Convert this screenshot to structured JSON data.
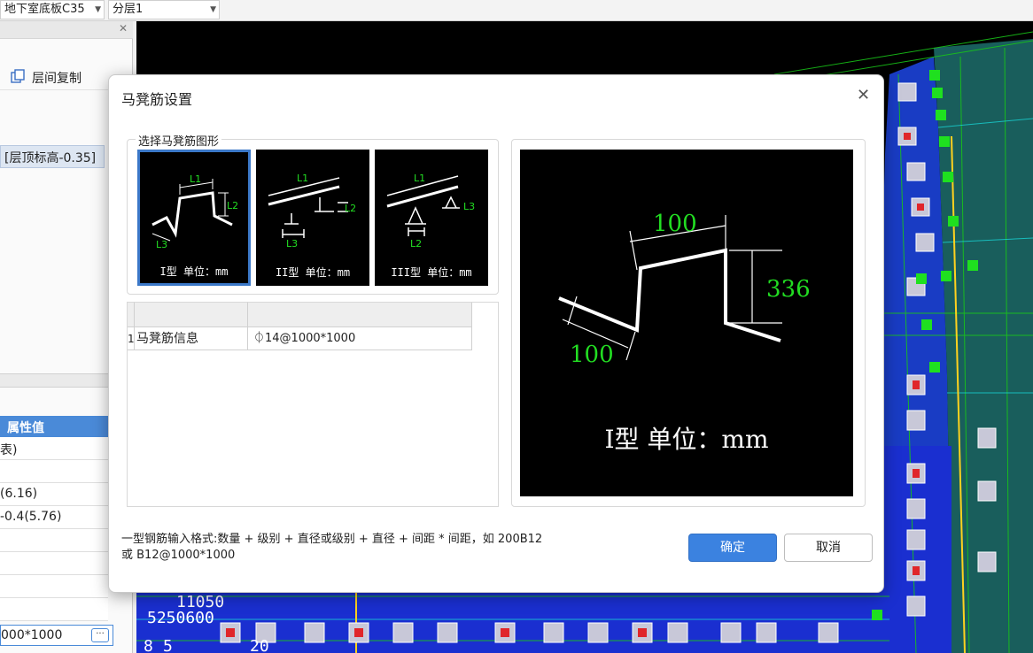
{
  "toolbar": {
    "component_combo": "地下室底板C35",
    "layer_combo": "分层1"
  },
  "left_panel": {
    "copy_label": "层间复制",
    "floor_item": "[层顶标高-0.35]",
    "prop_header": "属性值",
    "prop_rows": [
      "表)",
      "(6.16)",
      "-0.4(5.76)"
    ],
    "prop_input_value": "000*1000",
    "ellipsis": "···"
  },
  "cad": {
    "texts": [
      "11050",
      "5250600",
      "20",
      "8",
      "5"
    ]
  },
  "dialog": {
    "title": "马凳筋设置",
    "group_title": "选择马凳筋图形",
    "shapes": [
      {
        "label": "I型 单位：mm",
        "l1": "L1",
        "l2": "L2",
        "l3": "L3",
        "selected": true
      },
      {
        "label": "II型 单位：mm",
        "l1": "L1",
        "l2": "L2",
        "l3": "L3",
        "selected": false
      },
      {
        "label": "III型 单位：mm",
        "l1": "L1",
        "l2": "L2",
        "l3": "L3",
        "selected": false
      }
    ],
    "table": {
      "row_index": "1",
      "row_name": "马凳筋信息",
      "row_value": "⏀14@1000*1000"
    },
    "preview": {
      "dim_l1": "100",
      "dim_l2": "336",
      "dim_l3": "100",
      "label": "I型 单位：mm"
    },
    "hint_line1": "一型钢筋输入格式:数量 + 级别 + 直径或级别 + 直径 + 间距 * 间距，如 200B12",
    "hint_line2": "或 B12@1000*1000",
    "ok_label": "确定",
    "cancel_label": "取消"
  },
  "colors": {
    "accent": "#3b82e0",
    "dim_green": "#22dd22",
    "cad_blue": "#1a2fd0",
    "selected_border": "#3b78c8"
  }
}
